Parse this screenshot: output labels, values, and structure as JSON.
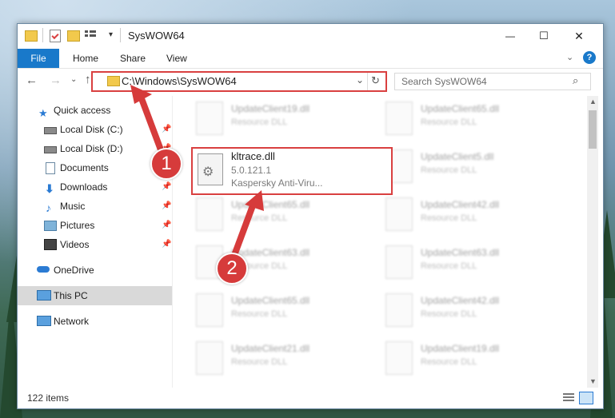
{
  "window": {
    "title": "SysWOW64",
    "controls": {
      "minimize": "—",
      "maximize": "☐",
      "close": "✕"
    }
  },
  "ribbon": {
    "tabs": [
      {
        "label": "File"
      },
      {
        "label": "Home"
      },
      {
        "label": "Share"
      },
      {
        "label": "View"
      }
    ],
    "help": "?"
  },
  "address": {
    "path": "C:\\Windows\\SysWOW64",
    "search_placeholder": "Search SysWOW64"
  },
  "nav": {
    "items": [
      {
        "label": "Quick access",
        "icon": "star-icon",
        "pinned": false
      },
      {
        "label": "Local Disk (C:)",
        "icon": "drive-icon",
        "pinned": true
      },
      {
        "label": "Local Disk (D:)",
        "icon": "drive-icon",
        "pinned": true
      },
      {
        "label": "Documents",
        "icon": "documents-icon",
        "pinned": true
      },
      {
        "label": "Downloads",
        "icon": "downloads-icon",
        "pinned": true
      },
      {
        "label": "Music",
        "icon": "music-icon",
        "pinned": true
      },
      {
        "label": "Pictures",
        "icon": "pictures-icon",
        "pinned": true
      },
      {
        "label": "Videos",
        "icon": "videos-icon",
        "pinned": true
      },
      {
        "label": "OneDrive",
        "icon": "cloud-icon",
        "pinned": false
      },
      {
        "label": "This PC",
        "icon": "computer-icon",
        "pinned": false,
        "selected": true
      },
      {
        "label": "Network",
        "icon": "network-icon",
        "pinned": false
      }
    ]
  },
  "files": {
    "selected": {
      "name": "kltrace.dll",
      "version": "5.0.121.1",
      "description": "Kaspersky Anti-Viru..."
    },
    "left_column": [
      {
        "name": "UpdateClient19.dll",
        "type": "Resource DLL"
      },
      {
        "name": "UpdateClient65.dll",
        "type": "Resource DLL"
      },
      {
        "name": "UpdateClient63.dll",
        "type": "Resource DLL"
      },
      {
        "name": "UpdateClient65.dll",
        "type": "Resource DLL"
      },
      {
        "name": "UpdateClient21.dll",
        "type": "Resource DLL"
      }
    ],
    "right_column": [
      {
        "name": "UpdateClient65.dll",
        "type": "Resource DLL"
      },
      {
        "name": "UpdateClient5.dll",
        "type": "Resource DLL"
      },
      {
        "name": "UpdateClient42.dll",
        "type": "Resource DLL"
      },
      {
        "name": "UpdateClient63.dll",
        "type": "Resource DLL"
      },
      {
        "name": "UpdateClient42.dll",
        "type": "Resource DLL"
      },
      {
        "name": "UpdateClient19.dll",
        "type": "Resource DLL"
      }
    ]
  },
  "status": {
    "item_count": "122 items"
  },
  "annotations": {
    "step1": "1",
    "step2": "2",
    "color": "#d63b3b"
  }
}
